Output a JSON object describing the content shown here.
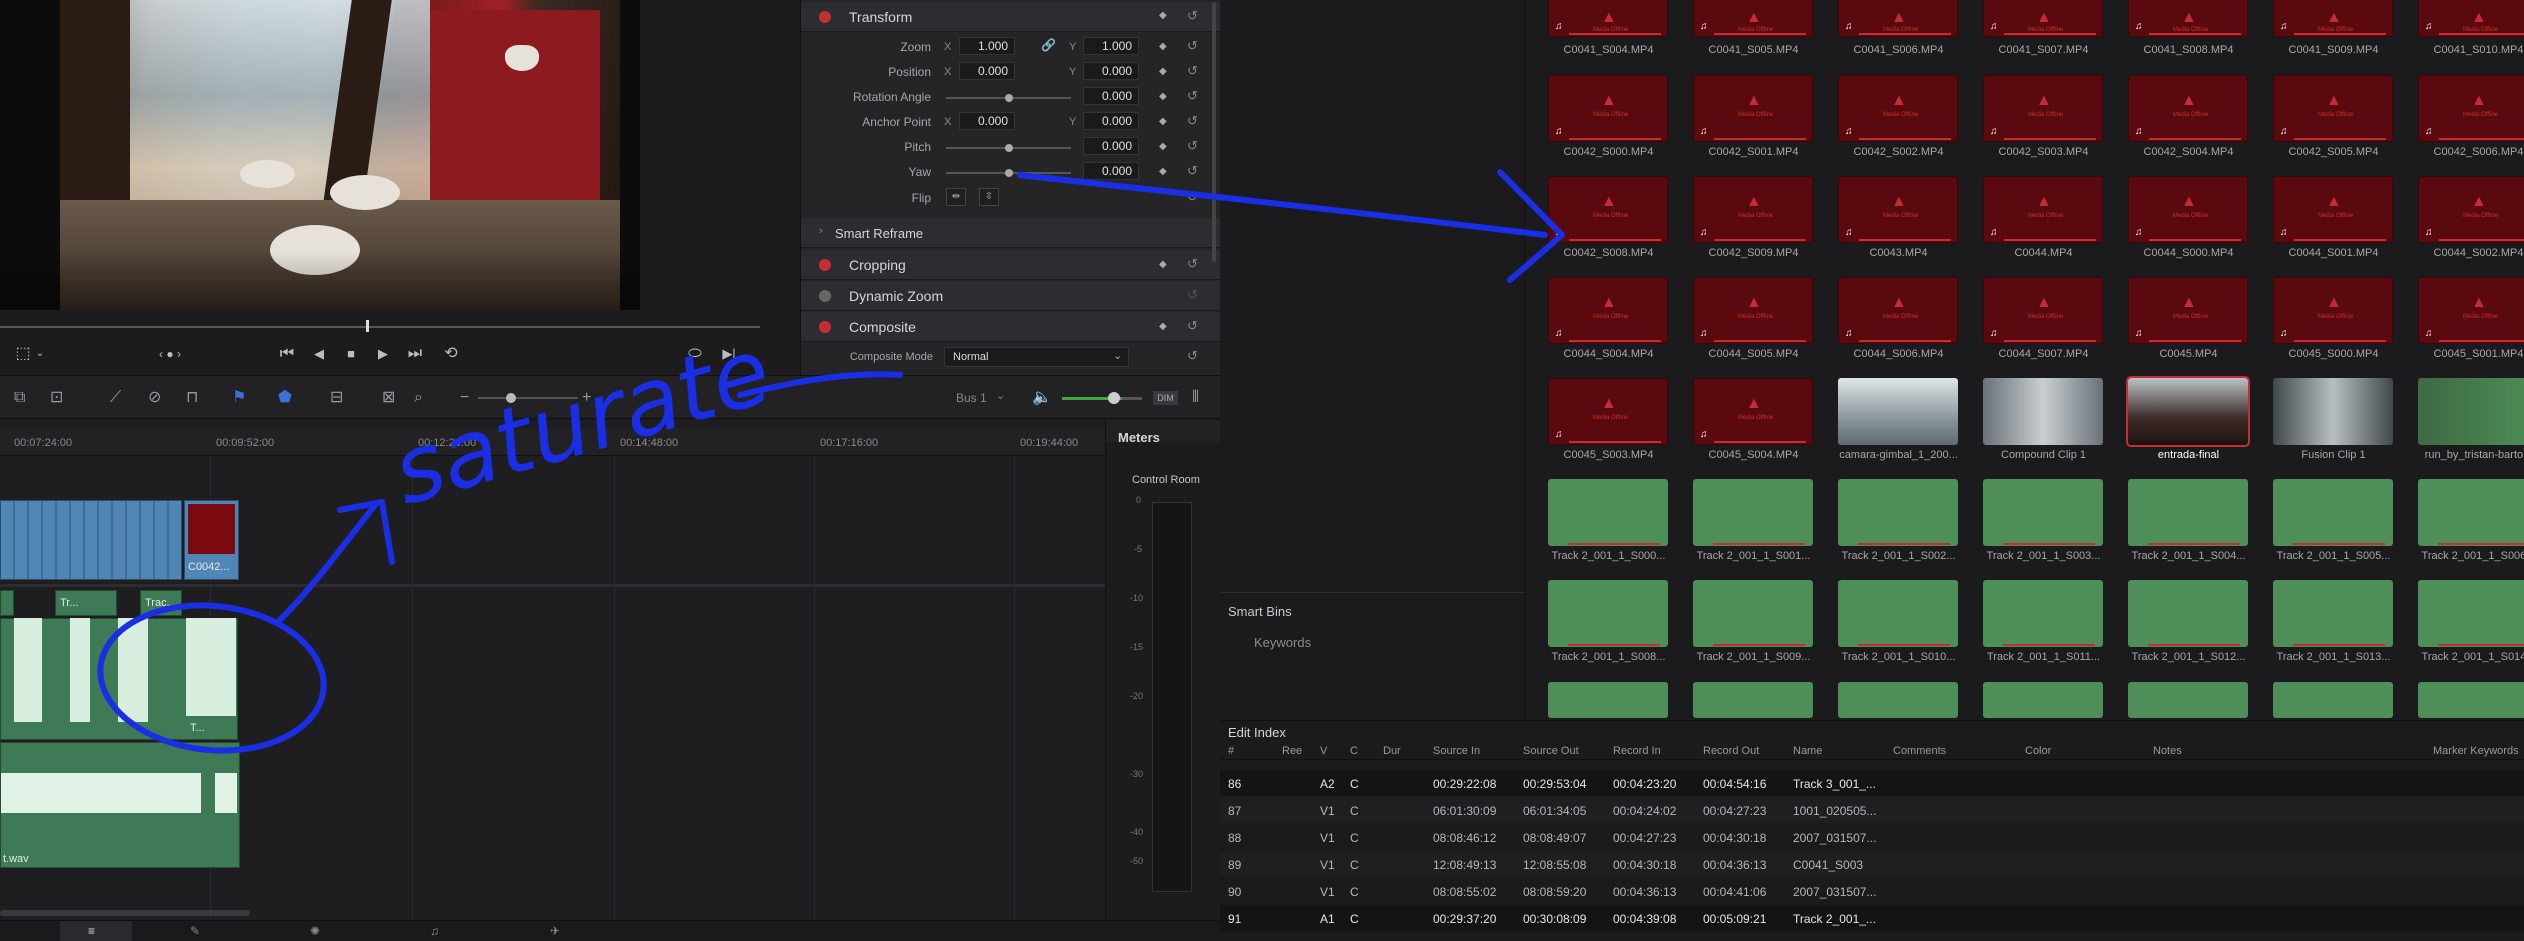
{
  "inspector": {
    "transform": {
      "title": "Transform",
      "zoom_label": "Zoom",
      "zoom_x": "1.000",
      "zoom_y": "1.000",
      "position_label": "Position",
      "position_x": "0.000",
      "position_y": "0.000",
      "rotation_label": "Rotation Angle",
      "rotation_value": "0.000",
      "anchor_label": "Anchor Point",
      "anchor_x": "0.000",
      "anchor_y": "0.000",
      "pitch_label": "Pitch",
      "pitch_value": "0.000",
      "yaw_label": "Yaw",
      "yaw_value": "0.000",
      "flip_label": "Flip",
      "axis_x": "X",
      "axis_y": "Y"
    },
    "smart_reframe": "Smart Reframe",
    "cropping": "Cropping",
    "dynamic_zoom": "Dynamic Zoom",
    "composite": {
      "title": "Composite",
      "mode_label": "Composite Mode",
      "mode_value": "Normal"
    }
  },
  "transport": {
    "timecode_dots": "‹ ● ›"
  },
  "timeline_toolbar": {
    "bus_label": "Bus 1",
    "dim_label": "DIM"
  },
  "ruler": [
    "00:07:24:00",
    "00:09:52:00",
    "00:12:20:00",
    "00:14:48:00",
    "00:17:16:00",
    "00:19:44:00"
  ],
  "timeline_clips": {
    "video_clip_name": "C0042...",
    "audio_clip_1": "Tr...",
    "audio_clip_2": "Trac...",
    "audio_clip_3": "T...",
    "audio_wav": "t.wav"
  },
  "meters": {
    "title": "Meters",
    "control_room": "Control Room",
    "scale": [
      "0",
      "-5",
      "-10",
      "-15",
      "-20",
      "-30",
      "-40",
      "-50"
    ]
  },
  "pool": {
    "rows": [
      [
        "C0041_S004.MP4",
        "C0041_S005.MP4",
        "C0041_S006.MP4",
        "C0041_S007.MP4",
        "C0041_S008.MP4",
        "C0041_S009.MP4",
        "C0041_S010.MP4"
      ],
      [
        "C0042_S000.MP4",
        "C0042_S001.MP4",
        "C0042_S002.MP4",
        "C0042_S003.MP4",
        "C0042_S004.MP4",
        "C0042_S005.MP4",
        "C0042_S006.MP4"
      ],
      [
        "C0042_S008.MP4",
        "C0042_S009.MP4",
        "C0043.MP4",
        "C0044.MP4",
        "C0044_S000.MP4",
        "C0044_S001.MP4",
        "C0044_S002.MP4"
      ],
      [
        "C0044_S004.MP4",
        "C0044_S005.MP4",
        "C0044_S006.MP4",
        "C0044_S007.MP4",
        "C0045.MP4",
        "C0045_S000.MP4",
        "C0045_S001.MP4"
      ],
      [
        "C0045_S003.MP4",
        "C0045_S004.MP4",
        "camara-gimbal_1_200...",
        "Compound Clip 1",
        "entrada-final",
        "Fusion Clip 1",
        "run_by_tristan-barto..."
      ],
      [
        "Track 2_001_1_S000...",
        "Track 2_001_1_S001...",
        "Track 2_001_1_S002...",
        "Track 2_001_1_S003...",
        "Track 2_001_1_S004...",
        "Track 2_001_1_S005...",
        "Track 2_001_1_S006..."
      ],
      [
        "Track 2_001_1_S008...",
        "Track 2_001_1_S009...",
        "Track 2_001_1_S010...",
        "Track 2_001_1_S011...",
        "Track 2_001_1_S012...",
        "Track 2_001_1_S013...",
        "Track 2_001_1_S014..."
      ]
    ],
    "offline_text": "Media Offline",
    "smart_bins": "Smart Bins",
    "keywords": "Keywords"
  },
  "edit_index": {
    "title": "Edit Index",
    "columns": [
      "#",
      "Ree",
      "V",
      "C",
      "Dur",
      "Source In",
      "Source Out",
      "Record In",
      "Record Out",
      "Name",
      "Comments",
      "Color",
      "Notes",
      "Marker Keywords"
    ],
    "rows": [
      [
        "86",
        "",
        "A2",
        "C",
        "",
        "00:29:22:08",
        "00:29:53:04",
        "00:04:23:20",
        "00:04:54:16",
        "Track 3_001_..."
      ],
      [
        "87",
        "",
        "V1",
        "C",
        "",
        "06:01:30:09",
        "06:01:34:05",
        "00:04:24:02",
        "00:04:27:23",
        "1001_020505..."
      ],
      [
        "88",
        "",
        "V1",
        "C",
        "",
        "08:08:46:12",
        "08:08:49:07",
        "00:04:27:23",
        "00:04:30:18",
        "2007_031507..."
      ],
      [
        "89",
        "",
        "V1",
        "C",
        "",
        "12:08:49:13",
        "12:08:55:08",
        "00:04:30:18",
        "00:04:36:13",
        "C0041_S003"
      ],
      [
        "90",
        "",
        "V1",
        "C",
        "",
        "08:08:55:02",
        "08:08:59:20",
        "00:04:36:13",
        "00:04:41:06",
        "2007_031507..."
      ],
      [
        "91",
        "",
        "A1",
        "C",
        "",
        "00:29:37:20",
        "00:30:08:09",
        "00:04:39:08",
        "00:05:09:21",
        "Track 2_001_..."
      ]
    ]
  },
  "annotation_text": "saturate",
  "colors": {
    "accent_red": "#c42d34",
    "clip_blue": "#4f86b5",
    "clip_green": "#3f7a56",
    "annotation_blue": "#1a2ee6"
  }
}
